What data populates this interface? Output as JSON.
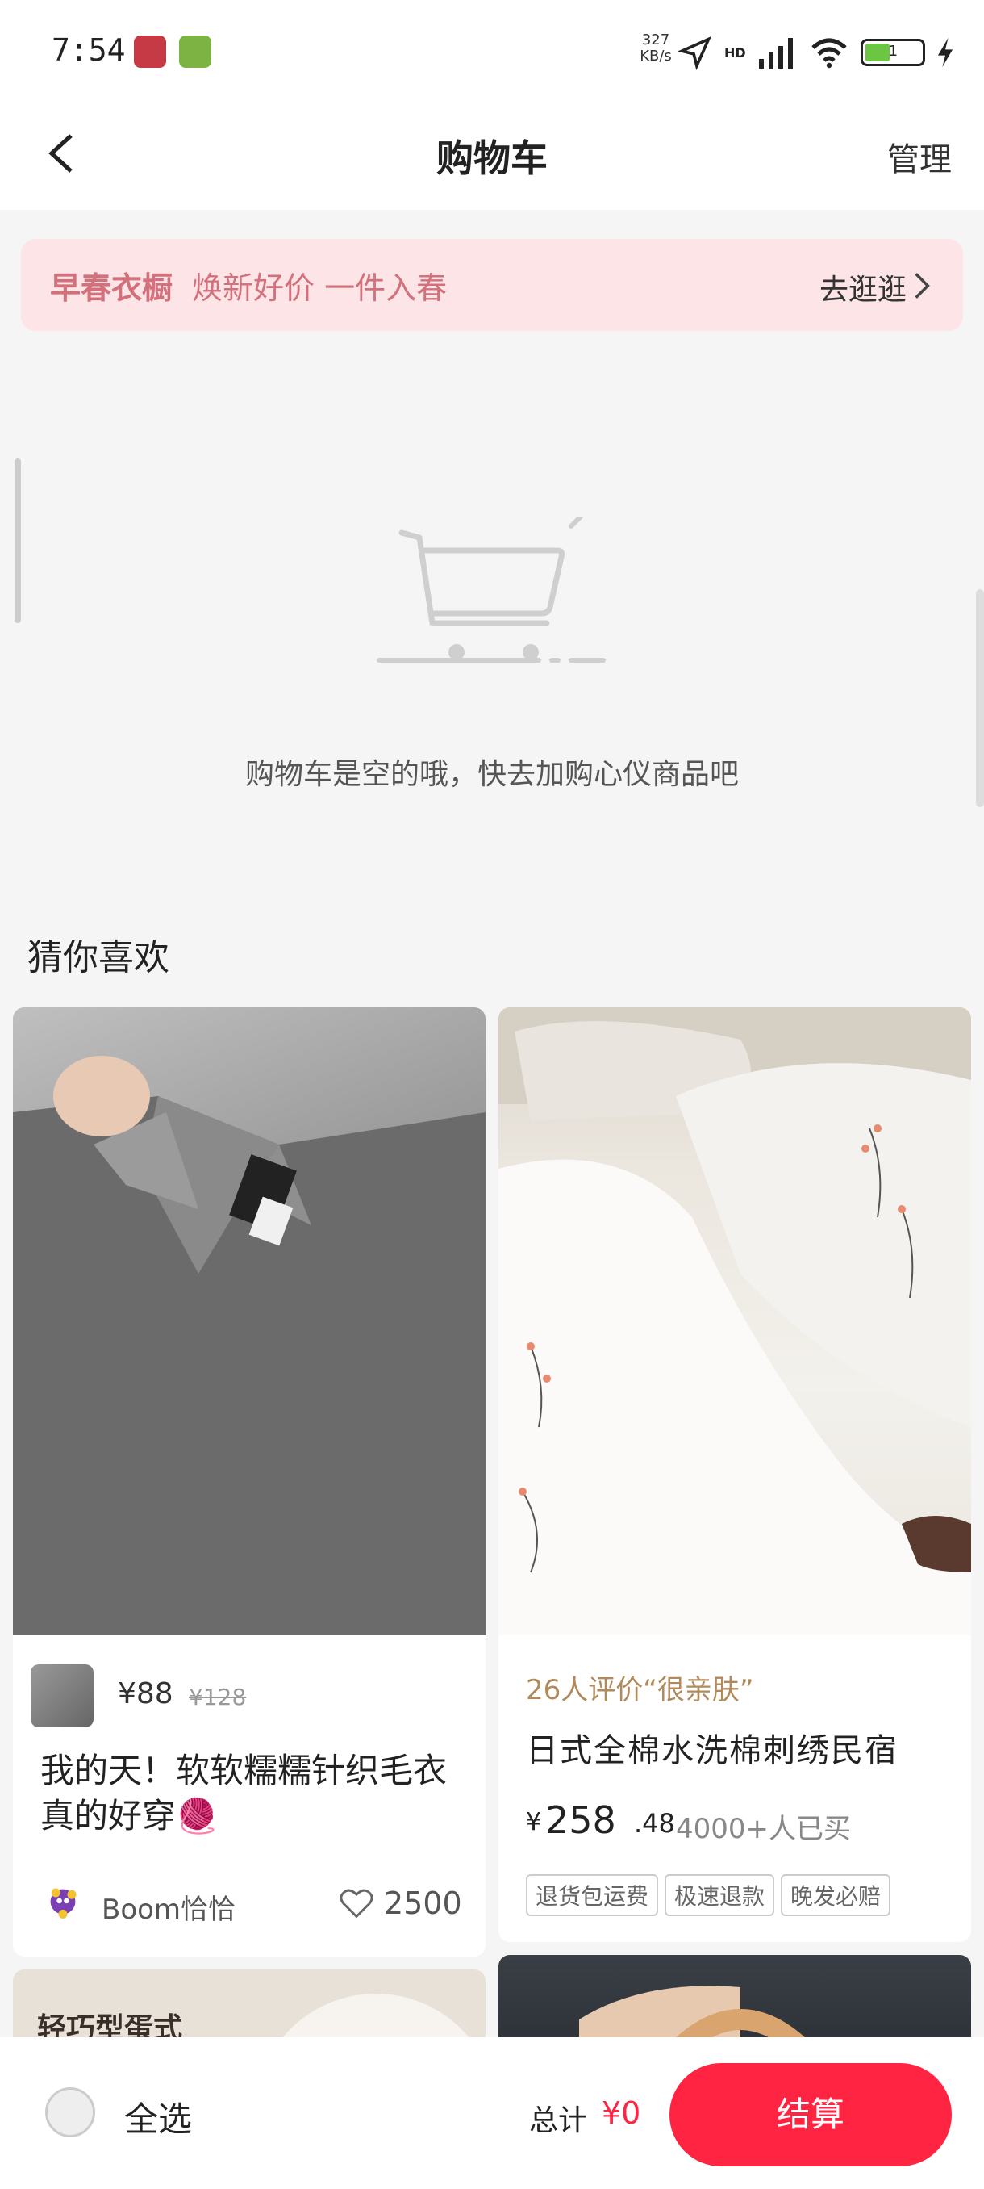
{
  "status_bar": {
    "time": "7:54",
    "net_speed_value": "327",
    "net_speed_unit": "KB/s",
    "network": "HD",
    "battery_level": "1"
  },
  "header": {
    "title": "购物车",
    "manage": "管理"
  },
  "banner": {
    "tag": "早春衣橱",
    "subtitle": "焕新好价 一件入春",
    "action": "去逛逛"
  },
  "empty_cart": {
    "message": "购物车是空的哦，快去加购心仪商品吧"
  },
  "recommend": {
    "title": "猜你喜欢",
    "items": [
      {
        "price": "¥88",
        "original_price": "¥128",
        "title": "我的天！软软糯糯针织毛衣真的好穿🧶",
        "author": "Boom恰恰",
        "likes": "2500"
      },
      {
        "reviews": "26人评价“很亲肤”",
        "title": "日式全棉水洗棉刺绣民宿",
        "price_symbol": "¥",
        "price_int": "258",
        "price_dec": ".48",
        "sold": "4000+人已买",
        "tags": [
          "退货包运费",
          "极速退款",
          "晚发必赔"
        ]
      },
      {
        "overlay_text": "轻巧型蛋式"
      }
    ]
  },
  "bottom_bar": {
    "select_all": "全选",
    "total_label": "总计",
    "total_value": "¥0",
    "checkout": "结算"
  },
  "colors": {
    "accent": "#ff2442",
    "banner_bg": "#fde4e6",
    "banner_text": "#d2717b"
  }
}
